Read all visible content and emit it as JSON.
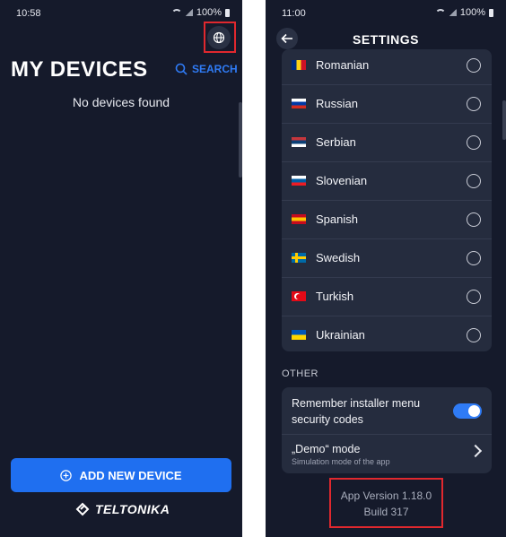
{
  "left": {
    "status": {
      "time": "10:58",
      "battery": "100%"
    },
    "title": "MY DEVICES",
    "search_label": "SEARCH",
    "empty_text": "No devices found",
    "add_button": "ADD NEW DEVICE",
    "brand": "TELTONIKA",
    "icons": {
      "globe": "globe-icon",
      "search": "search-icon",
      "add": "plus-circle-icon"
    }
  },
  "right": {
    "status": {
      "time": "11:00",
      "battery": "100%"
    },
    "title": "SETTINGS",
    "languages": [
      {
        "label": "Romanian",
        "flag": [
          "#002b7f",
          "#fcd116",
          "#ce1126"
        ],
        "dir": "v"
      },
      {
        "label": "Russian",
        "flag": [
          "#ffffff",
          "#0039a6",
          "#d52b1e"
        ],
        "dir": "h"
      },
      {
        "label": "Serbian",
        "flag": [
          "#c6363c",
          "#0c4076",
          "#ffffff"
        ],
        "dir": "h"
      },
      {
        "label": "Slovenian",
        "flag": [
          "#ffffff",
          "#005da4",
          "#ed1c24"
        ],
        "dir": "h"
      },
      {
        "label": "Spanish",
        "flag": [
          "#c60b1e",
          "#ffc400",
          "#c60b1e"
        ],
        "dir": "h"
      },
      {
        "label": "Swedish",
        "flag": [
          "#006aa7",
          "#fecc00"
        ],
        "dir": "cross"
      },
      {
        "label": "Turkish",
        "flag": [
          "#e30a17",
          "#ffffff"
        ],
        "dir": "crescent"
      },
      {
        "label": "Ukrainian",
        "flag": [
          "#0057b7",
          "#ffd700"
        ],
        "dir": "h2"
      }
    ],
    "other_label": "OTHER",
    "remember_label": "Remember installer menu security codes",
    "remember_enabled": true,
    "demo_title": "„Demo“ mode",
    "demo_sub": "Simulation mode of the app",
    "version_line1": "App Version 1.18.0",
    "version_line2": "Build 317"
  },
  "colors": {
    "background": "#151a2b",
    "card": "#252c3e",
    "accent": "#2f7bf5",
    "highlight": "#e0282e"
  }
}
